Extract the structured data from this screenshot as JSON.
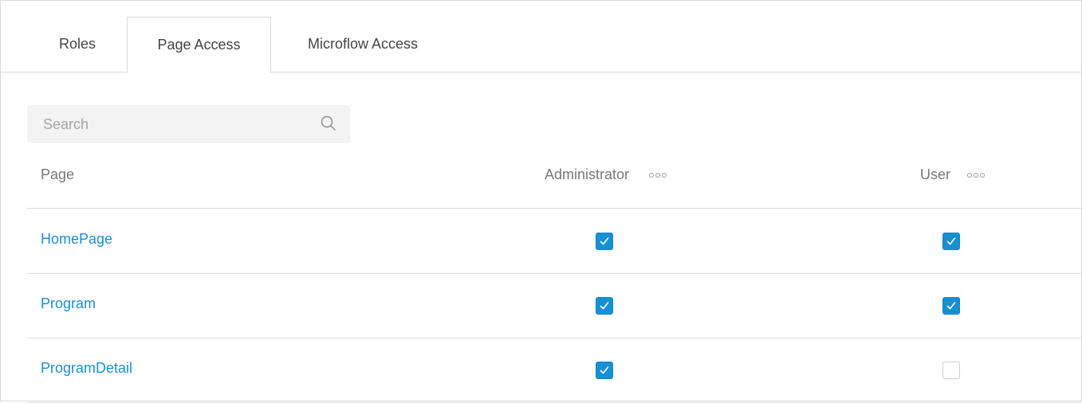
{
  "tabs": [
    {
      "label": "Roles",
      "active": false
    },
    {
      "label": "Page Access",
      "active": true
    },
    {
      "label": "Microflow Access",
      "active": false
    }
  ],
  "search": {
    "placeholder": "Search",
    "value": "",
    "icon": "search-icon"
  },
  "table": {
    "columns": {
      "page": "Page",
      "administrator": "Administrator",
      "user": "User"
    },
    "more_icon": "more-options-icon",
    "rows": [
      {
        "page": "HomePage",
        "administrator": true,
        "user": true
      },
      {
        "page": "Program",
        "administrator": true,
        "user": true
      },
      {
        "page": "ProgramDetail",
        "administrator": true,
        "user": false
      }
    ]
  },
  "colors": {
    "accent": "#168fd3",
    "link": "#1a8fd1",
    "border": "#d9d9d9",
    "search_bg": "#f3f3f3"
  }
}
